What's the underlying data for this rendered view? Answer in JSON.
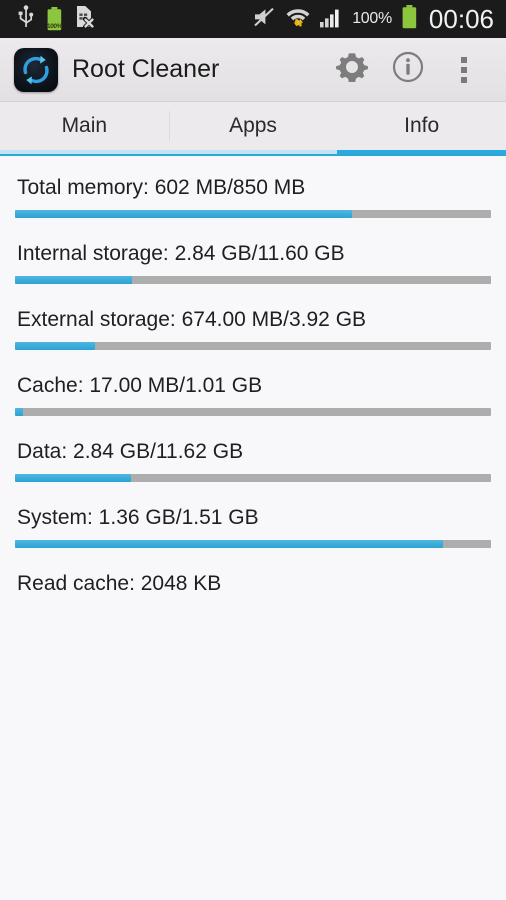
{
  "statusbar": {
    "left_icons": [
      "usb-icon",
      "battery-100-icon",
      "no-sim-card-icon"
    ],
    "battery_label": "100%",
    "right_icons": [
      "mute-icon",
      "wifi-icon",
      "signal-bars-icon",
      "battery-icon"
    ],
    "battery_percent": "100%",
    "clock": "00:06"
  },
  "appbar": {
    "app_icon": "root-cleaner-app-icon",
    "title": "Root Cleaner",
    "actions": [
      {
        "name": "settings-button",
        "icon": "gear-icon"
      },
      {
        "name": "info-button",
        "icon": "info-circle-icon"
      },
      {
        "name": "overflow-menu-button",
        "icon": "three-dots-icon"
      }
    ]
  },
  "tabs": {
    "items": [
      {
        "label": "Main",
        "active": false
      },
      {
        "label": "Apps",
        "active": false
      },
      {
        "label": "Info",
        "active": true
      }
    ],
    "active_index": 2
  },
  "colors": {
    "accent": "#29abe2",
    "accent_light": "#bfe4f3",
    "track": "#adadad",
    "background": "#f8f7fa",
    "appbar": "#eceaec",
    "statusbar": "#1b1b1b",
    "battery_green": "#8cc63e"
  },
  "info": {
    "rows": [
      {
        "label": "Total memory: 602 MB/850 MB",
        "percent": 70.8,
        "has_bar": true
      },
      {
        "label": "Internal storage: 2.84 GB/11.60 GB",
        "percent": 24.5,
        "has_bar": true
      },
      {
        "label": "External storage: 674.00 MB/3.92 GB",
        "percent": 16.8,
        "has_bar": true
      },
      {
        "label": "Cache: 17.00 MB/1.01 GB",
        "percent": 1.7,
        "has_bar": true
      },
      {
        "label": "Data: 2.84 GB/11.62 GB",
        "percent": 24.4,
        "has_bar": true
      },
      {
        "label": "System: 1.36 GB/1.51 GB",
        "percent": 90.0,
        "has_bar": true
      },
      {
        "label": "Read cache: 2048 KB",
        "percent": null,
        "has_bar": false
      }
    ]
  }
}
